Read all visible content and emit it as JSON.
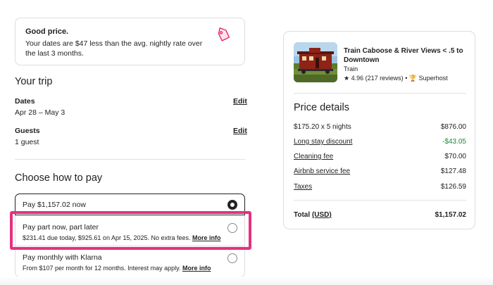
{
  "good_price": {
    "title": "Good price.",
    "text": "Your dates are $47 less than the avg. nightly rate over the last 3 months.",
    "icon": "price-tag-icon"
  },
  "trip": {
    "heading": "Your trip",
    "dates_label": "Dates",
    "dates_value": "Apr 28 – May 3",
    "guests_label": "Guests",
    "guests_value": "1 guest",
    "edit_label": "Edit"
  },
  "payment": {
    "heading": "Choose how to pay",
    "options": [
      {
        "title": "Pay $1,157.02 now",
        "selected": true
      },
      {
        "title": "Pay part now, part later",
        "sub": "$231.41 due today, $925.61 on Apr 15, 2025. No extra fees.",
        "link": "More info",
        "selected": false
      },
      {
        "title": "Pay monthly with Klarna",
        "sub": "From $107 per month for 12 months. Interest may apply.",
        "link": "More info",
        "selected": false
      }
    ]
  },
  "listing": {
    "title": "Train Caboose & River Views < .5 to Downtown",
    "type": "Train",
    "rating": "4.96",
    "reviews": "(217 reviews)",
    "separator": "•",
    "badge": "Superhost"
  },
  "price_details": {
    "heading": "Price details",
    "rows": [
      {
        "label": "$175.20 x 5 nights",
        "amount": "$876.00"
      },
      {
        "label": "Long stay discount",
        "amount": "-$43.05"
      },
      {
        "label": "Cleaning fee",
        "amount": "$70.00"
      },
      {
        "label": "Airbnb service fee",
        "amount": "$127.48"
      },
      {
        "label": "Taxes",
        "amount": "$126.59"
      }
    ],
    "total_label": "Total",
    "total_currency": "(USD)",
    "total_amount": "$1,157.02"
  },
  "colors": {
    "highlight": "#e5317f",
    "discount": "#1a8a3a",
    "brand": "#e31c5f"
  }
}
